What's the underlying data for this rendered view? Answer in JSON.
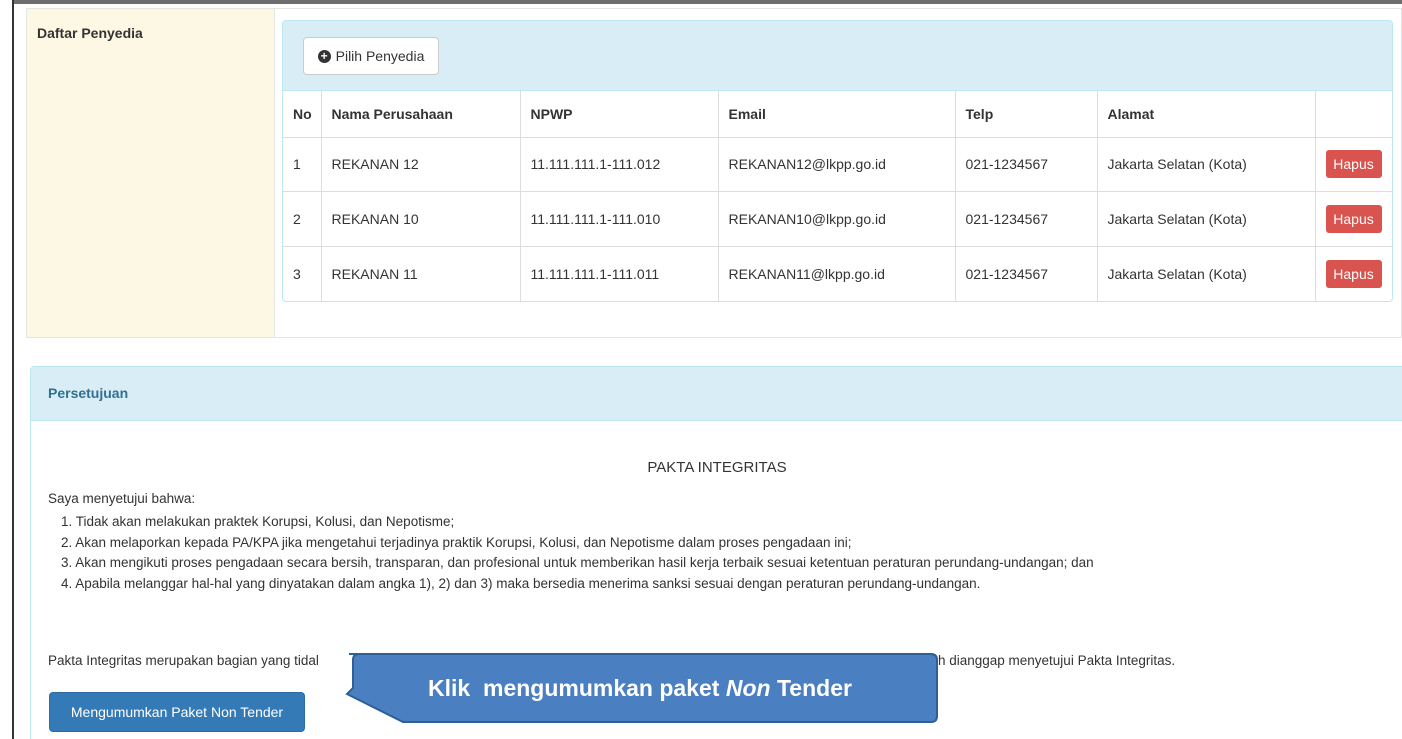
{
  "penyedia": {
    "label": "Daftar Penyedia",
    "pilih_button": "Pilih Penyedia",
    "columns": [
      "No",
      "Nama Perusahaan",
      "NPWP",
      "Email",
      "Telp",
      "Alamat",
      ""
    ],
    "rows": [
      {
        "no": "1",
        "nama": "REKANAN 12",
        "npwp": "11.111.111.1-111.012",
        "email": "REKANAN12@lkpp.go.id",
        "telp": "021-1234567",
        "alamat": "Jakarta Selatan (Kota)",
        "action": "Hapus"
      },
      {
        "no": "2",
        "nama": "REKANAN 10",
        "npwp": "11.111.111.1-111.010",
        "email": "REKANAN10@lkpp.go.id",
        "telp": "021-1234567",
        "alamat": "Jakarta Selatan (Kota)",
        "action": "Hapus"
      },
      {
        "no": "3",
        "nama": "REKANAN 11",
        "npwp": "11.111.111.1-111.011",
        "email": "REKANAN11@lkpp.go.id",
        "telp": "021-1234567",
        "alamat": "Jakarta Selatan (Kota)",
        "action": "Hapus"
      }
    ]
  },
  "persetujuan": {
    "heading": "Persetujuan",
    "pakta_title": "PAKTA INTEGRITAS",
    "intro": "Saya menyetujui bahwa:",
    "terms": [
      "1. Tidak akan melakukan praktek Korupsi, Kolusi, dan Nepotisme;",
      "2. Akan melaporkan kepada PA/KPA jika mengetahui terjadinya praktik Korupsi, Kolusi, dan Nepotisme dalam proses pengadaan ini;",
      "3. Akan mengikuti proses pengadaan secara bersih, transparan, dan profesional untuk memberikan hasil kerja terbaik sesuai ketentuan peraturan perundang-undangan; dan",
      "4. Apabila melanggar hal-hal yang dinyatakan dalam angka 1), 2) dan 3) maka bersedia menerima sanksi sesuai dengan peraturan perundang-undangan."
    ],
    "footer_left": "Pakta Integritas merupakan bagian yang tidal",
    "footer_right": "a telah dianggap menyetujui Pakta Integritas.",
    "submit_button": "Mengumumkan Paket Non Tender"
  },
  "callout": {
    "text_before": "Klik  mengumumkan paket ",
    "text_italic": "Non",
    "text_after": " Tender"
  },
  "colors": {
    "label_bg": "#fcf8e3",
    "panel_head_bg": "#d9edf7",
    "primary": "#337ab7",
    "danger": "#d9534f",
    "callout_fill": "#4a7fc1"
  }
}
